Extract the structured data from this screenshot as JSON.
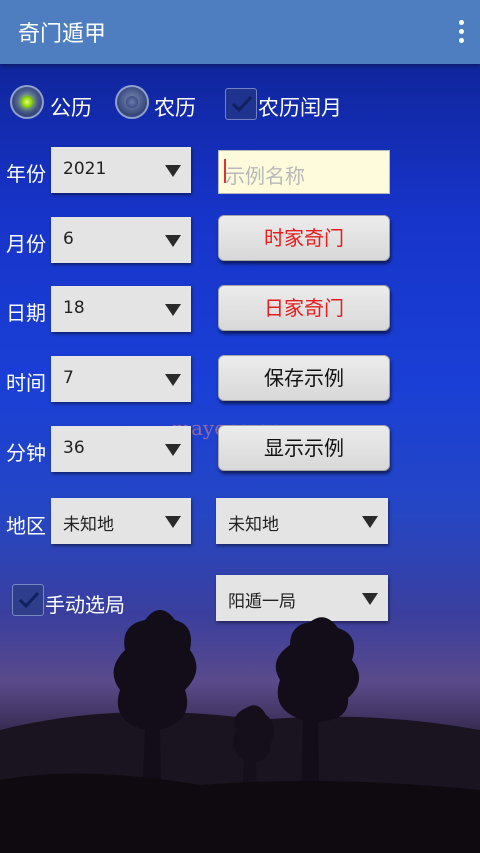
{
  "appbar": {
    "title": "奇门遁甲",
    "menu_icon": "more-vert-icon"
  },
  "calendar": {
    "solar_label": "公历",
    "lunar_label": "农历",
    "leap_label": "农历闰月",
    "solar_selected": true,
    "leap_checked": true
  },
  "rows": {
    "year": {
      "label": "年份",
      "value": "2021"
    },
    "month": {
      "label": "月份",
      "value": "6"
    },
    "day": {
      "label": "日期",
      "value": "18"
    },
    "hour": {
      "label": "时间",
      "value": "7"
    },
    "minute": {
      "label": "分钟",
      "value": "36"
    },
    "region": {
      "label": "地区",
      "value": "未知地",
      "value2": "未知地"
    }
  },
  "example_name": {
    "placeholder": "示例名称",
    "value": ""
  },
  "buttons": {
    "hour_qimen": "时家奇门",
    "day_qimen": "日家奇门",
    "save_example": "保存示例",
    "show_example": "显示示例"
  },
  "manual": {
    "label": "手动选局",
    "checked": true,
    "ju_value": "阳遁一局"
  },
  "watermark": "mayona.cn",
  "colors": {
    "appbar": "#4f7ec0",
    "button_red_text": "#e81c1c",
    "input_bg": "#fdfbdc"
  }
}
